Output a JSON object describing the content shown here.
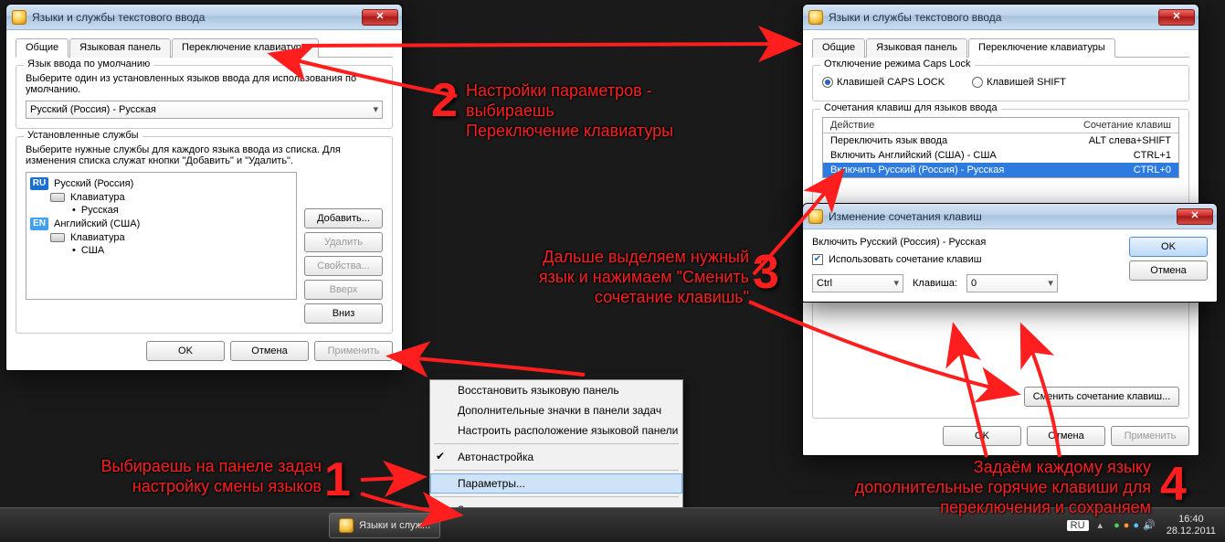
{
  "window_title": "Языки и службы текстового ввода",
  "win1": {
    "tabs": [
      "Общие",
      "Языковая панель",
      "Переключение клавиатуры"
    ],
    "active_tab": 0,
    "default_group_title": "Язык ввода по умолчанию",
    "default_group_desc": "Выберите один из установленных языков ввода для использования по умолчанию.",
    "default_select": "Русский (Россия) - Русская",
    "installed_group_title": "Установленные службы",
    "installed_group_desc": "Выберите нужные службы для каждого языка ввода из списка. Для изменения списка служат кнопки \"Добавить\" и \"Удалить\".",
    "tree": {
      "ru_label": "Русский (Россия)",
      "ru_kb_label": "Клавиатура",
      "ru_kb_layout": "Русская",
      "en_label": "Английский (США)",
      "en_kb_label": "Клавиатура",
      "en_kb_layout": "США"
    },
    "btns": {
      "add": "Добавить...",
      "remove": "Удалить",
      "props": "Свойства...",
      "up": "Вверх",
      "down": "Вниз"
    },
    "ok": "OK",
    "cancel": "Отмена",
    "apply": "Применить"
  },
  "win2": {
    "tabs": [
      "Общие",
      "Языковая панель",
      "Переключение клавиатуры"
    ],
    "active_tab": 2,
    "caps_group": "Отключение режима Caps Lock",
    "radio_caps": "Клавишей CAPS LOCK",
    "radio_shift": "Клавишей SHIFT",
    "hot_group": "Сочетания клавиш для языков ввода",
    "col_action": "Действие",
    "col_combo": "Сочетание клавиш",
    "rows": [
      {
        "action": "Переключить язык ввода",
        "combo": "ALT слева+SHIFT"
      },
      {
        "action": "Включить Английский (США) - США",
        "combo": "CTRL+1"
      },
      {
        "action": "Включить Русский (Россия) - Русская",
        "combo": "CTRL+0"
      }
    ],
    "change_btn": "Сменить сочетание клавиш...",
    "ok": "OK",
    "cancel": "Отмена",
    "apply": "Применить"
  },
  "win3": {
    "title": "Изменение сочетания клавиш",
    "target": "Включить Русский (Россия) - Русская",
    "chk": "Использовать сочетание клавиш",
    "mod_select": "Ctrl",
    "key_label": "Клавиша:",
    "key_select": "0",
    "ok": "OK",
    "cancel": "Отмена"
  },
  "ctx_menu": {
    "items": [
      "Восстановить языковую панель",
      "Дополнительные значки в панели задач",
      "Настроить расположение языковой панели"
    ],
    "auto": "Автонастройка",
    "params": "Параметры...",
    "close": "Закрыть языковую панель"
  },
  "taskbar": {
    "app": "Языки и служ...",
    "lang_ind": "RU",
    "time": "16:40",
    "date": "28.12.2011"
  },
  "ann": {
    "a1": "Выбираешь на панеле задач\nнастройку смены языков",
    "a2": "Настройки параметров -\nвыбираешь\nПереключение клавиатуры",
    "a3": "Дальше выделяем нужный\nязык и  нажимаем \"Сменить\nсочетание клавишь\"",
    "a4": "Задаём каждому языку\nдополнительные горячие клавиши для\nпереключения и сохраняем",
    "n1": "1",
    "n2": "2",
    "n3": "3",
    "n4": "4"
  }
}
